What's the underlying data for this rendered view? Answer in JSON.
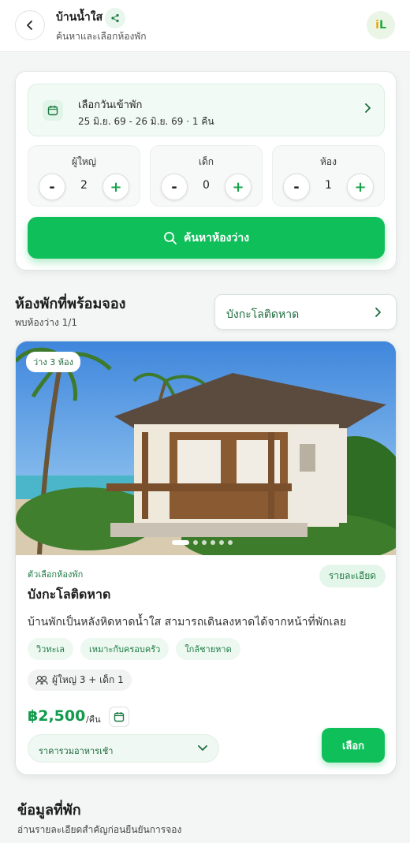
{
  "header": {
    "title": "บ้านน้ำใส",
    "subtitle": "ค้นหาและเลือกห้องพัก",
    "logo_text_i": "i",
    "logo_text_l": "L",
    "icons": {
      "back": "chevron-left-icon",
      "share": "share-icon"
    }
  },
  "booking": {
    "date_label": "เลือกวันเข้าพัก",
    "date_value": "25 มิ.ย. 69 - 26 มิ.ย. 69 · 1 คืน",
    "counters": [
      {
        "label": "ผู้ใหญ่",
        "value": "2"
      },
      {
        "label": "เด็ก",
        "value": "0"
      },
      {
        "label": "ห้อง",
        "value": "1"
      }
    ],
    "minus": "-",
    "plus": "+",
    "search_label": "ค้นหาห้องว่าง"
  },
  "rooms_section": {
    "title": "ห้องพักที่พร้อมจอง",
    "subtitle": "พบห้องว่าง 1/1",
    "filter_label": "บังกะโลติดหาด"
  },
  "room": {
    "availability": "ว่าง 3 ห้อง",
    "image_count": 6,
    "active_image": 1,
    "option_label": "ตัวเลือกห้องพัก",
    "details_label": "รายละเอียด",
    "name": "บังกะโลติดหาด",
    "description": "บ้านพักเป็นหลังหิดหาดน้ำใส สามารถเดินลงหาดได้จากหน้าที่พักเลย",
    "tags": [
      "วิวทะเล",
      "เหมาะกับครอบครัว",
      "ใกล้ชายหาด"
    ],
    "guests": "ผู้ใหญ่ 3 + เด็ก 1",
    "price": "฿2,500",
    "per_night": "/คืน",
    "meal_option": "ราคารวมอาหารเช้า",
    "choose_label": "เลือก"
  },
  "info": {
    "title": "ข้อมูลที่พัก",
    "subtitle": "อ่านรายละเอียดสำคัญก่อนยืนยันการจอง"
  },
  "colors": {
    "primary": "#0fbf5a",
    "primary_text": "#1d7a43",
    "price": "#129a4d"
  }
}
